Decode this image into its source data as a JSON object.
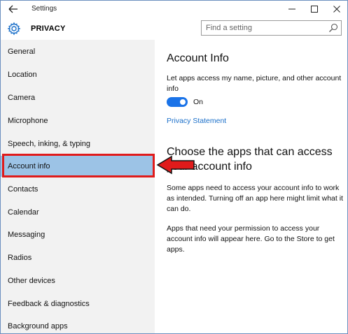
{
  "window": {
    "title": "Settings"
  },
  "header": {
    "title": "PRIVACY",
    "search_placeholder": "Find a setting"
  },
  "sidebar": {
    "items": [
      {
        "label": "General"
      },
      {
        "label": "Location"
      },
      {
        "label": "Camera"
      },
      {
        "label": "Microphone"
      },
      {
        "label": "Speech, inking, & typing"
      },
      {
        "label": "Account info",
        "active": true
      },
      {
        "label": "Contacts"
      },
      {
        "label": "Calendar"
      },
      {
        "label": "Messaging"
      },
      {
        "label": "Radios"
      },
      {
        "label": "Other devices"
      },
      {
        "label": "Feedback & diagnostics"
      },
      {
        "label": "Background apps"
      }
    ]
  },
  "main": {
    "heading": "Account Info",
    "description": "Let apps access my name, picture, and other account info",
    "toggle_state": "On",
    "privacy_link": "Privacy Statement",
    "choose_heading": "Choose the apps that can access your account info",
    "paragraph1": "Some apps need to access your account info to work as intended. Turning off an app here might limit what it can do.",
    "paragraph2": "Apps that need your permission to access your account info will appear here. Go to the Store to get apps."
  },
  "colors": {
    "accent": "#1a73e8",
    "active_item": "#9cc3e6",
    "annotation_red": "#e01b1b"
  }
}
